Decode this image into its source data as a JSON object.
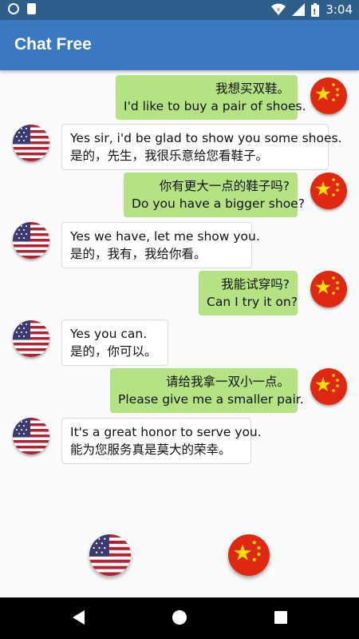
{
  "status_bar": {
    "time": "3:04"
  },
  "app_bar": {
    "title": "Chat Free"
  },
  "colors": {
    "app_bar": "#3a78c2",
    "status_bar": "#2e5f8c",
    "outgoing_bubble": "#b5e384",
    "incoming_bubble": "#ffffff"
  },
  "messages": [
    {
      "side": "china",
      "line1": "我想买双鞋。",
      "line2": "I'd like to buy a pair of shoes."
    },
    {
      "side": "usa",
      "line1": "Yes sir, i'd be glad to show you some shoes.",
      "line2": "是的，先生，我很乐意给您看鞋子。"
    },
    {
      "side": "china",
      "line1": "你有更大一点的鞋子吗?",
      "line2": "Do you have a bigger shoe?"
    },
    {
      "side": "usa",
      "line1": "Yes we have, let me show you.",
      "line2": "是的，我有，我给你看。"
    },
    {
      "side": "china",
      "line1": "我能试穿吗?",
      "line2": "Can I try it on?"
    },
    {
      "side": "usa",
      "line1": "Yes you can.",
      "line2": "是的，你可以。"
    },
    {
      "side": "china",
      "line1": "请给我拿一双小一点。",
      "line2": "Please give me a smaller pair."
    },
    {
      "side": "usa",
      "line1": "It's a great honor to serve you.",
      "line2": "能为您服务真是莫大的荣幸。"
    }
  ],
  "bottom_controls": {
    "left_icon": "usa-flag-icon",
    "right_icon": "china-flag-icon"
  }
}
